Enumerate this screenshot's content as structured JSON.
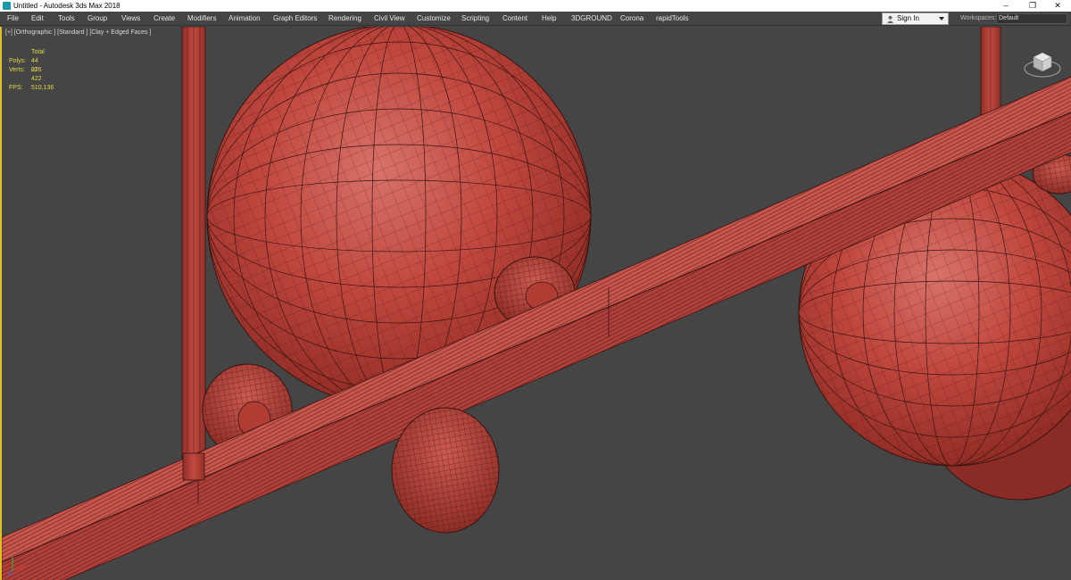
{
  "window": {
    "title": "Untitled - Autodesk 3ds Max 2018",
    "controls": [
      "minimize-icon",
      "restore-icon",
      "close-icon"
    ]
  },
  "menu": {
    "items": [
      "File",
      "Edit",
      "Tools",
      "Group",
      "Views",
      "Create",
      "Modifiers",
      "Animation",
      "Graph Editors",
      "Rendering",
      "Civil View",
      "Customize",
      "Scripting",
      "Content",
      "Help",
      "3DGROUND",
      "Corona",
      "rapidTools"
    ],
    "sign_in": "Sign In",
    "workspaces_label": "Workspaces:",
    "workspace_value": "Default"
  },
  "viewport": {
    "label": "[+] [Orthographic ] [Standard ] [Clay + Edged Faces ]",
    "stats": {
      "header": "Total",
      "polys_label": "Polys:",
      "polys_value": "44 016",
      "verts_label": "Verts:",
      "verts_value": "22 422",
      "fps_label": "FPS:",
      "fps_value": "510,136"
    }
  },
  "colors": {
    "viewport_bg": "#454545",
    "clay": "#c0473e",
    "edge": "#3a1412",
    "stats_text": "#e2d84a",
    "active_border": "#e0c020"
  }
}
